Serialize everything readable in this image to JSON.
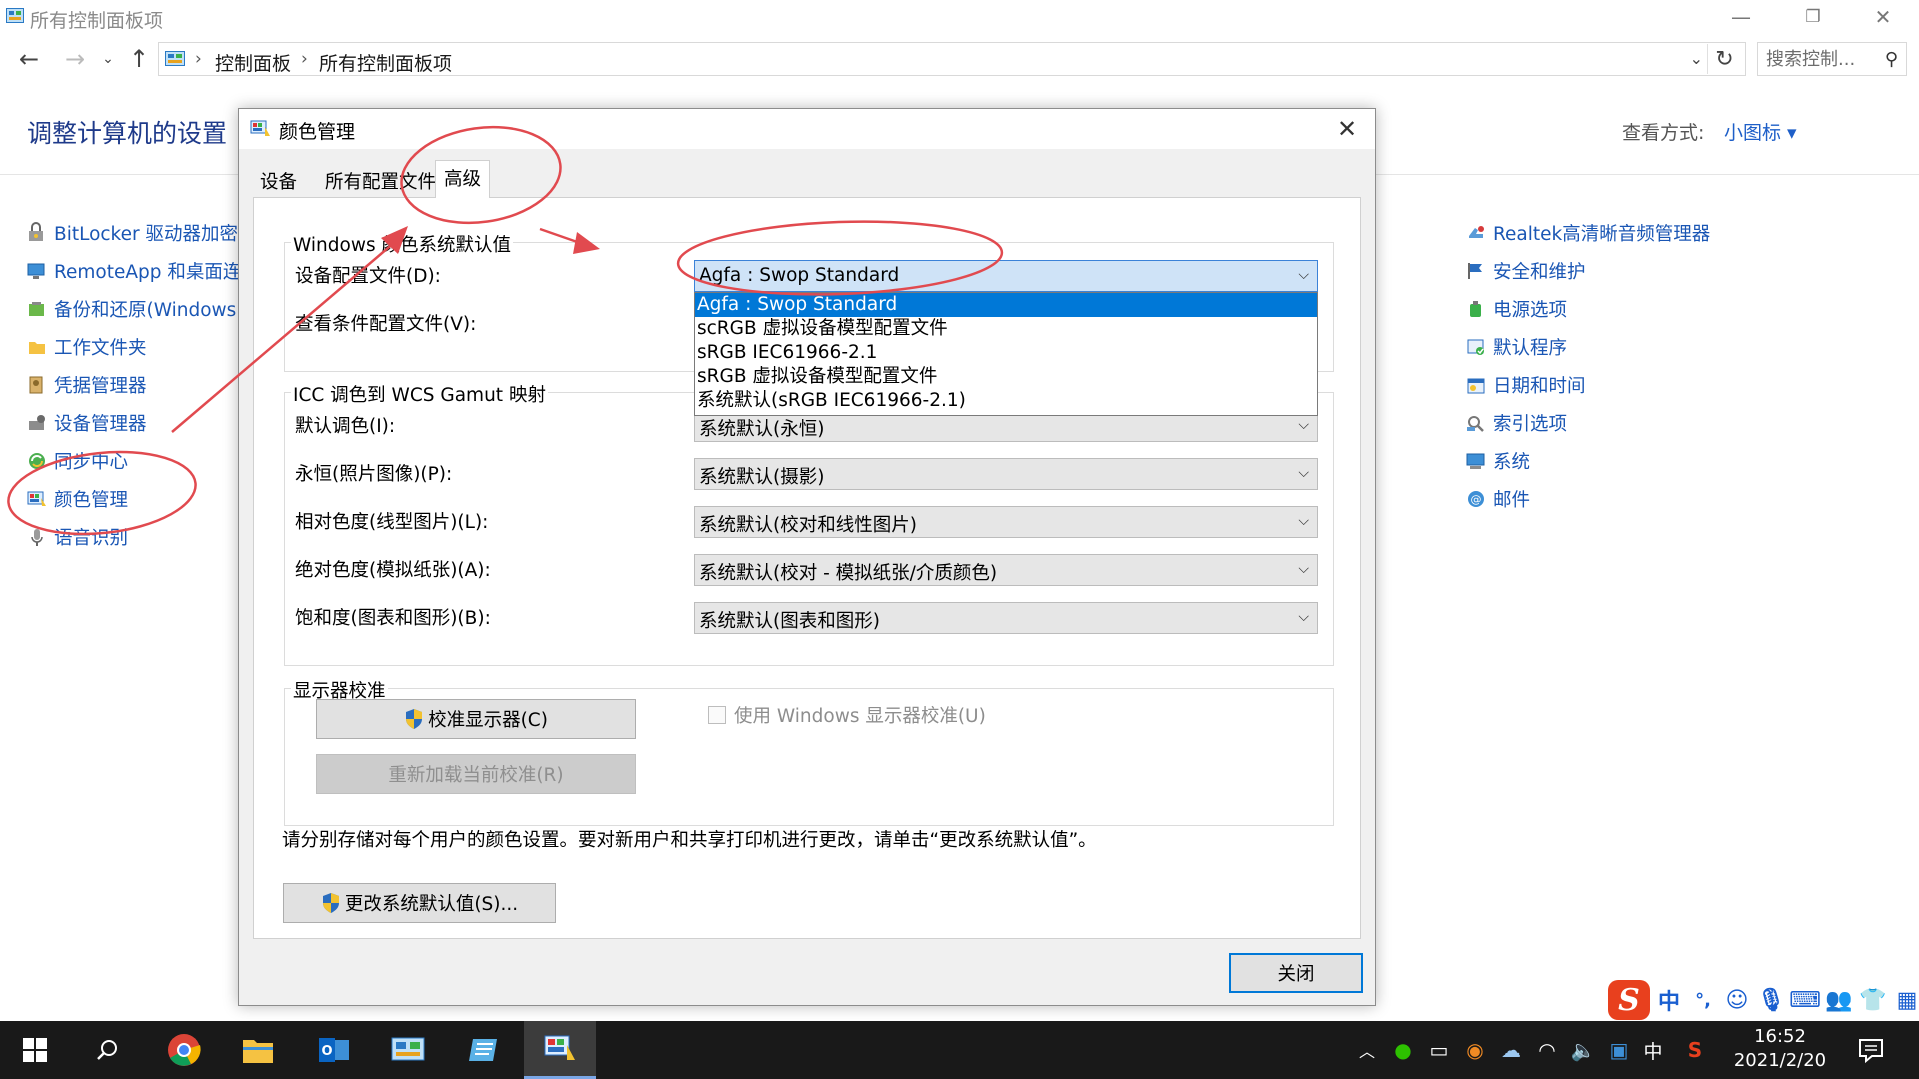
{
  "window": {
    "title": "所有控制面板项",
    "minimize_glyph": "—",
    "restore_glyph": "❐",
    "close_glyph": "✕"
  },
  "address": {
    "crumbs": [
      "控制面板",
      "所有控制面板项"
    ],
    "search_placeholder": "搜索控制..."
  },
  "heading": "调整计算机的设置",
  "view_by": {
    "label": "查看方式:",
    "value": "小图标 ▾"
  },
  "left_items": [
    {
      "label": "BitLocker 驱动器加密",
      "icon": "bitlocker-icon"
    },
    {
      "label": "RemoteApp 和桌面连",
      "icon": "remoteapp-icon"
    },
    {
      "label": "备份和还原(Windows",
      "icon": "backup-icon"
    },
    {
      "label": "工作文件夹",
      "icon": "work-folders-icon"
    },
    {
      "label": "凭据管理器",
      "icon": "credential-manager-icon"
    },
    {
      "label": "设备管理器",
      "icon": "device-manager-icon"
    },
    {
      "label": "同步中心",
      "icon": "sync-center-icon"
    },
    {
      "label": "颜色管理",
      "icon": "color-management-icon"
    },
    {
      "label": "语音识别",
      "icon": "speech-recognition-icon"
    }
  ],
  "right_items": [
    {
      "label": "Realtek高清晰音频管理器",
      "icon": "realtek-audio-icon"
    },
    {
      "label": "安全和维护",
      "icon": "security-maintenance-icon"
    },
    {
      "label": "电源选项",
      "icon": "power-options-icon"
    },
    {
      "label": "默认程序",
      "icon": "default-programs-icon"
    },
    {
      "label": "日期和时间",
      "icon": "date-time-icon"
    },
    {
      "label": "索引选项",
      "icon": "indexing-options-icon"
    },
    {
      "label": "系统",
      "icon": "system-icon"
    },
    {
      "label": "邮件",
      "icon": "mail-icon"
    }
  ],
  "dialog": {
    "title": "颜色管理",
    "tabs": [
      "设备",
      "所有配置文件",
      "高级"
    ],
    "active_tab": "高级",
    "group_defaults": "Windows 颜色系统默认值",
    "device_profile_label": "设备配置文件(D):",
    "device_profile_value": "Agfa : Swop Standard",
    "viewing_cond_label": "查看条件配置文件(V):",
    "dropdown_options": [
      "Agfa : Swop Standard",
      "scRGB 虚拟设备模型配置文件",
      "sRGB IEC61966-2.1",
      "sRGB 虚拟设备模型配置文件",
      "系统默认(sRGB IEC61966-2.1)"
    ],
    "group_gamut": "ICC 调色到 WCS Gamut 映射",
    "gamut_rows": [
      {
        "label": "默认调色(I):",
        "value": "系统默认(永恒)"
      },
      {
        "label": "永恒(照片图像)(P):",
        "value": "系统默认(摄影)"
      },
      {
        "label": "相对色度(线型图片)(L):",
        "value": "系统默认(校对和线性图片)"
      },
      {
        "label": "绝对色度(模拟纸张)(A):",
        "value": "系统默认(校对 - 模拟纸张/介质颜色)"
      },
      {
        "label": "饱和度(图表和图形)(B):",
        "value": "系统默认(图表和图形)"
      }
    ],
    "group_calibration": "显示器校准",
    "calibrate_button": "校准显示器(C)",
    "reload_button": "重新加载当前校准(R)",
    "use_windows_calibration": "使用 Windows 显示器校准(U)",
    "info_text": "请分别存储对每个用户的颜色设置。要对新用户和共享打印机进行更改，请单击“更改系统默认值”。",
    "change_defaults_button": "更改系统默认值(S)...",
    "close_button": "关闭"
  },
  "ime": {
    "logo": "S",
    "mode": "中",
    "punct": "°,"
  },
  "taskbar": {
    "time": "16:52",
    "date": "2021/2/20",
    "input_lang": "中"
  },
  "colors": {
    "link": "#1a56b4",
    "heading": "#1e3a8a",
    "annotation": "#e14a4f",
    "selection": "#0078d7",
    "taskbar": "#191919"
  }
}
